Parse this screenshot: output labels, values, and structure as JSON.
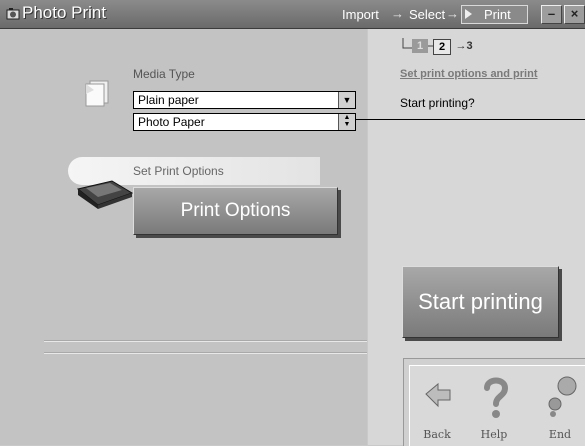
{
  "window": {
    "title": "Photo Print"
  },
  "breadcrumb": {
    "import": "Import",
    "select": "Select",
    "print": "Print",
    "arrow": "→"
  },
  "window_controls": {
    "minimize": "–",
    "close": "×"
  },
  "steps": {
    "step1": "1",
    "step2": "2",
    "step3": "→3"
  },
  "right_panel": {
    "link": "Set print options and print",
    "question": "Start printing?"
  },
  "media": {
    "label": "Media Type",
    "select_value": "Plain paper",
    "paper_value": "Photo Paper"
  },
  "print_options": {
    "section_label": "Set Print Options",
    "button_label": "Print Options"
  },
  "start_button": {
    "label": "Start printing"
  },
  "nav": {
    "back": "Back",
    "help": "Help",
    "end": "End"
  },
  "colors": {
    "titlebar": "#7a7a7a",
    "left_panel": "#c3c3c3",
    "right_panel": "#d7d7d7",
    "button": "#8e8e8e"
  }
}
